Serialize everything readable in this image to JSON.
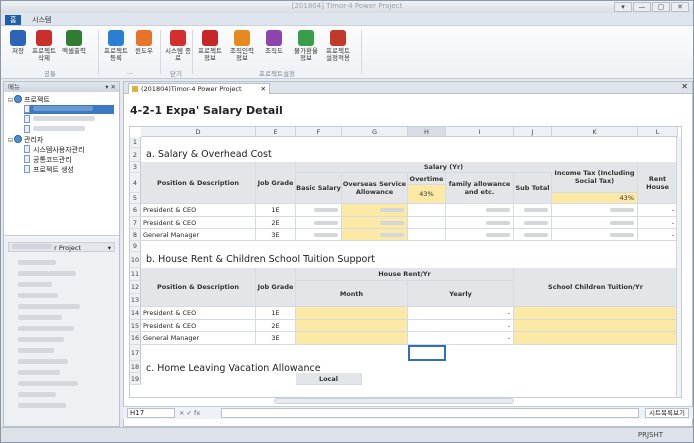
{
  "window": {
    "title": "[201804] Timor-4 Power Project",
    "controls": [
      "▾",
      "—",
      "▢",
      "✕"
    ]
  },
  "ribbon_tabs": [
    "홈",
    "시스템"
  ],
  "ribbon": {
    "buttons": [
      {
        "label": "저장",
        "icon": "save-icon",
        "color": "#2d64b8"
      },
      {
        "label": "프로젝트 삭제",
        "icon": "delete-doc-icon",
        "color": "#c9302c"
      },
      {
        "label": "엑셀출력",
        "icon": "excel-icon",
        "color": "#2e7d32"
      },
      {
        "label": "프로젝트 등록",
        "icon": "add-icon",
        "color": "#2a7fd4"
      },
      {
        "label": "윈도우",
        "icon": "window-icon",
        "color": "#e8732b"
      },
      {
        "label": "시스템 종료",
        "icon": "exit-icon",
        "color": "#d32f2f"
      },
      {
        "label": "프로젝트 정보",
        "icon": "project-info-icon",
        "color": "#c62828"
      },
      {
        "label": "조직인력 정보",
        "icon": "org-staff-icon",
        "color": "#e68a1f"
      },
      {
        "label": "조직도",
        "icon": "org-chart-icon",
        "color": "#8e44ad"
      },
      {
        "label": "물가환율 정보",
        "icon": "exchange-icon",
        "color": "#3a9d4a"
      },
      {
        "label": "프로젝트 설정적용",
        "icon": "settings-apply-icon",
        "color": "#c0392b"
      }
    ],
    "groups": [
      "공통",
      "...",
      "닫기",
      "프로젝트설정"
    ]
  },
  "left_panel": {
    "header": "메뉴",
    "tree": [
      {
        "label": "프로젝트",
        "level": 0,
        "icon": "project-node-icon"
      },
      {
        "label": "관리자",
        "level": 0,
        "icon": "admin-node-icon"
      },
      {
        "label": "시스템사용자관리",
        "level": 1,
        "icon": "doc-icon"
      },
      {
        "label": "공통코드관리",
        "level": 1,
        "icon": "doc-icon"
      },
      {
        "label": "프로젝트 생성",
        "level": 1,
        "icon": "doc-icon"
      }
    ],
    "lower_header": "r Project"
  },
  "document": {
    "tab_label": "(201804)Timor-4 Power Project",
    "sheet_title": "4-2-1 Expa' Salary Detail",
    "columns": [
      "D",
      "E",
      "F",
      "G",
      "H",
      "I",
      "J",
      "K",
      "L"
    ],
    "rows": [
      "1",
      "2",
      "3",
      "4",
      "5",
      "6",
      "7",
      "8",
      "9",
      "10",
      "11",
      "12",
      "13",
      "14",
      "15",
      "16",
      "17",
      "18",
      "19"
    ],
    "sections": {
      "a": "a. Salary & Overhead Cost",
      "b": "b. House Rent & Children School Tuition Support",
      "c": "c. Home Leaving Vacation Allowance"
    },
    "headers": {
      "position": "Position & Description",
      "job_grade": "Job Grade",
      "salary_yr": "Salary (Yr)",
      "basic_salary": "Basic Salary",
      "overseas": "Overseas Service Allowance",
      "overtime": "Overtime",
      "overtime_pct": "43%",
      "family": "family allowance and etc.",
      "subtotal": "Sub Total",
      "income_tax": "Income Tax (Including Social Tax)",
      "income_pct": "43%",
      "rent_house": "Rent House",
      "house_rent_yr": "House Rent/Yr",
      "month": "Month",
      "yearly": "Yearly",
      "school": "School Children Tuition/Yr",
      "local": "Local"
    },
    "salary_rows": [
      {
        "position": "President & CEO",
        "grade": "1E"
      },
      {
        "position": "President & CEO",
        "grade": "2E"
      },
      {
        "position": "General Manager",
        "grade": "3E"
      }
    ],
    "rent_rows": [
      {
        "position": "President & CEO",
        "grade": "1E",
        "yearly": "-"
      },
      {
        "position": "President & CEO",
        "grade": "2E",
        "yearly": "-"
      },
      {
        "position": "General Manager",
        "grade": "3E",
        "yearly": "-"
      }
    ],
    "dash": "-"
  },
  "formula_bar": {
    "cell_ref": "H17",
    "symbols": "× ✓ fx",
    "sheet_list_button": "시트목록보기"
  },
  "status_bar": {
    "text": "PRJSHT"
  }
}
